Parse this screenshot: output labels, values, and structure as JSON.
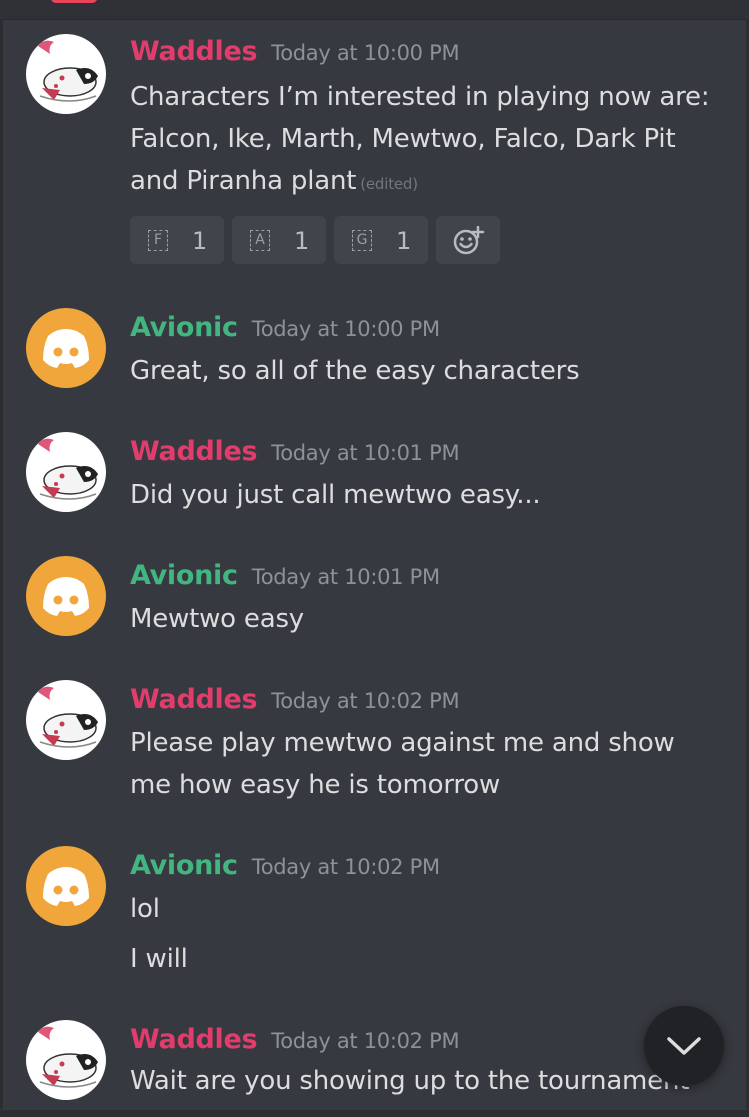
{
  "messages": [
    {
      "author": "Waddles",
      "timestamp": "Today at 10:00 PM",
      "lines": [
        "Characters I’m interested in playing now are:",
        "Falcon, Ike, Marth, Mewtwo, Falco, Dark Pit",
        "and Piranha plant"
      ],
      "edited": "(edited)",
      "reactions": [
        {
          "emoji": "F",
          "count": "1"
        },
        {
          "emoji": "A",
          "count": "1"
        },
        {
          "emoji": "G",
          "count": "1"
        }
      ]
    },
    {
      "author": "Avionic",
      "timestamp": "Today at 10:00 PM",
      "lines": [
        "Great, so all of the easy characters"
      ]
    },
    {
      "author": "Waddles",
      "timestamp": "Today at 10:01 PM",
      "lines": [
        "Did you just call mewtwo easy..."
      ]
    },
    {
      "author": "Avionic",
      "timestamp": "Today at 10:01 PM",
      "lines": [
        "Mewtwo easy"
      ]
    },
    {
      "author": "Waddles",
      "timestamp": "Today at 10:02 PM",
      "lines": [
        "Please play mewtwo against me and show",
        "me how easy he is tomorrow"
      ]
    },
    {
      "author": "Avionic",
      "timestamp": "Today at 10:02 PM",
      "lines": [
        "lol",
        "I will"
      ]
    },
    {
      "author": "Waddles",
      "timestamp": "Today at 10:02 PM",
      "lines": [
        "Wait are you showing up to the tournament"
      ]
    }
  ],
  "icons": {
    "add_reaction": "smiley-plus-icon",
    "scroll_bottom": "chevron-down-icon",
    "avatar_avionic": "discord-logo-icon"
  },
  "colors": {
    "background": "#36393f",
    "waddles_name": "#e13c6b",
    "avionic_name": "#43b581",
    "avionic_avatar": "#f0a63a"
  }
}
